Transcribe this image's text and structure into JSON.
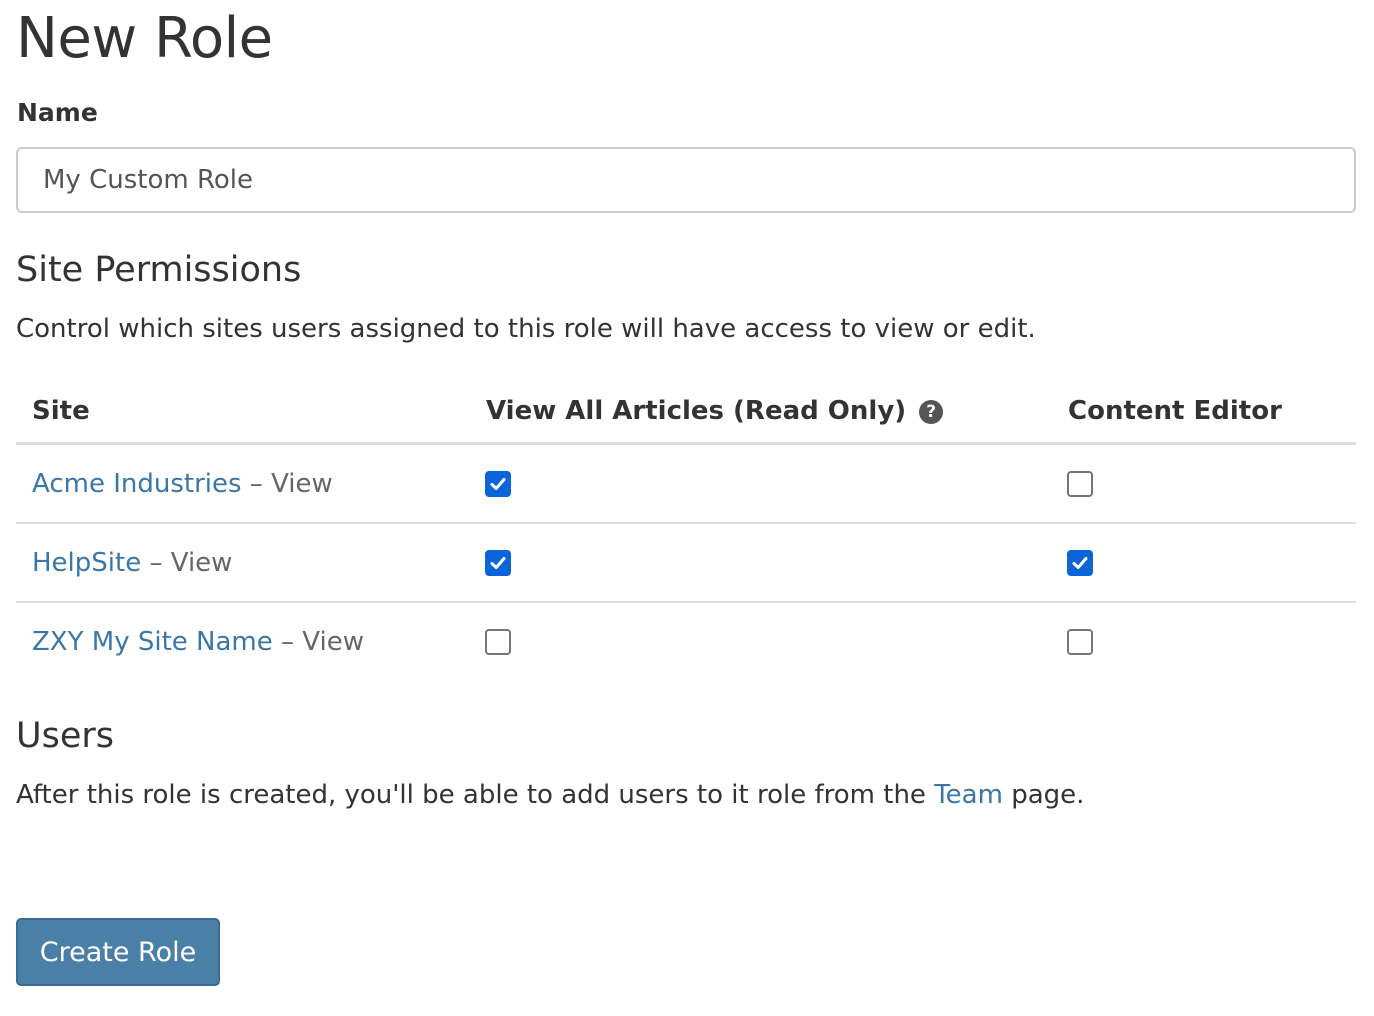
{
  "page_title": "New Role",
  "name_field": {
    "label": "Name",
    "value": "My Custom Role"
  },
  "site_permissions": {
    "heading": "Site Permissions",
    "description": "Control which sites users assigned to this role will have access to view or edit.",
    "columns": [
      "Site",
      "View All Articles (Read Only)",
      "Content Editor"
    ],
    "help_icon": "question-circle-icon",
    "rows": [
      {
        "site": "Acme Industries",
        "suffix": " – View",
        "view_all": true,
        "content_editor": false
      },
      {
        "site": "HelpSite",
        "suffix": " – View",
        "view_all": true,
        "content_editor": true
      },
      {
        "site": "ZXY My Site Name",
        "suffix": " – View",
        "view_all": false,
        "content_editor": false
      }
    ]
  },
  "users": {
    "heading": "Users",
    "text_before": "After this role is created, you'll be able to add users to it role from the ",
    "link": "Team",
    "text_after": " page."
  },
  "submit_label": "Create Role",
  "colors": {
    "link": "#3a77a6",
    "button": "#4a80a8",
    "checkbox_checked": "#0b64d8"
  }
}
